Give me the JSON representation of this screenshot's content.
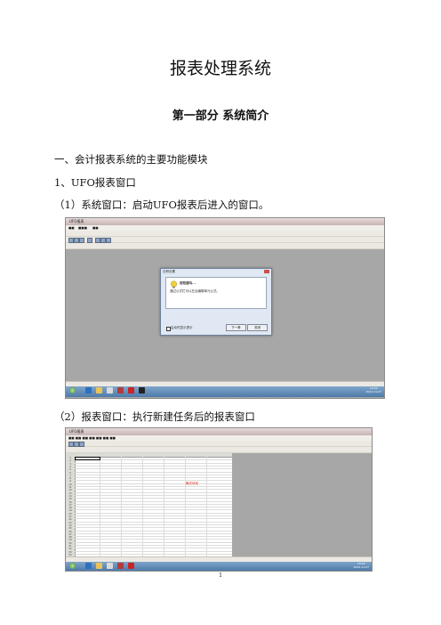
{
  "document": {
    "title": "报表处理系统",
    "part_heading": "第一部分  系统简介",
    "section_1": "一、会计报表系统的主要功能模块",
    "section_1_1": "1、UFO报表窗口",
    "item_1": "（1）系统窗口：启动UFO报表后进入的窗口。",
    "item_2": "（2）报表窗口：执行新建任务后的报表窗口",
    "page_number": "1"
  },
  "screenshot_1": {
    "app_title": "UFO报表",
    "os_taskbar_time": "10:03",
    "os_taskbar_date": "2012-11-27",
    "dialog": {
      "title": "日积月累",
      "heading": "您知道吗...",
      "tip": "通过公式栏可以在此编辑单元公式。",
      "checkbox_label": "启动时显示提示",
      "next_button": "下一条",
      "close_button": "关闭"
    }
  },
  "screenshot_2": {
    "app_title": "UFO报表",
    "mode_label": "格式状态",
    "os_taskbar_time": "10:03",
    "os_taskbar_date": "2012-11-27",
    "row_numbers": [
      "1",
      "2",
      "3",
      "4",
      "5",
      "6",
      "7",
      "8",
      "9",
      "10",
      "11",
      "12",
      "13",
      "14",
      "15",
      "16",
      "17",
      "18",
      "19",
      "20",
      "21",
      "22",
      "23",
      "24",
      "25",
      "26",
      "27",
      "28",
      "29",
      "30",
      "31",
      "32",
      "33",
      "34"
    ]
  },
  "colors": {
    "workspace_gray": "#a7a7a7",
    "taskbar_blue": "#4e7aa8",
    "mode_label_red": "#d4261f"
  }
}
